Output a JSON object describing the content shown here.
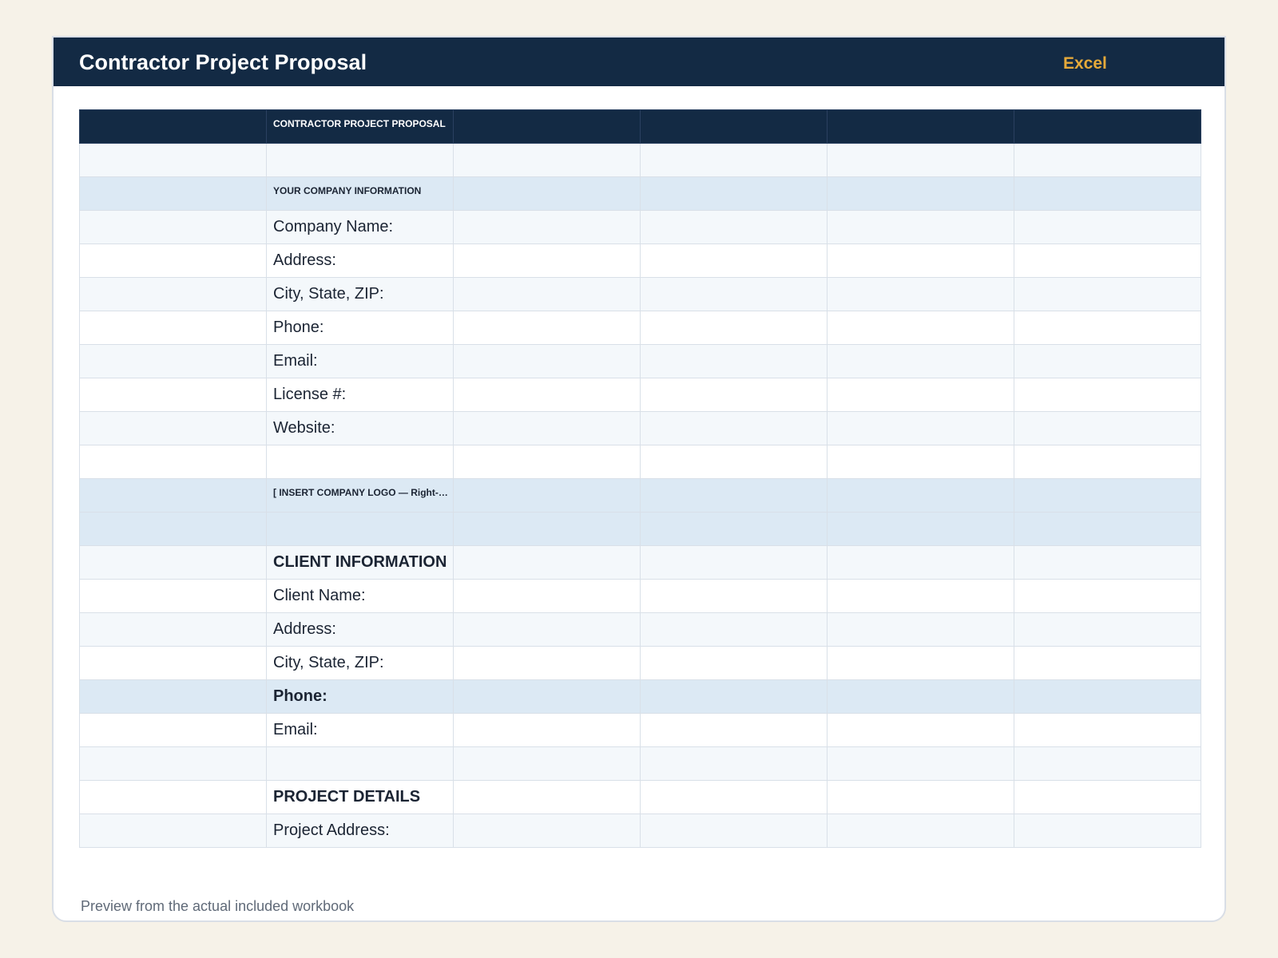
{
  "header": {
    "title": "Contractor Project Proposal",
    "badge": "Excel"
  },
  "sheet": {
    "title": "CONTRACTOR PROJECT PROPOSAL",
    "company_section": "YOUR COMPANY INFORMATION",
    "company_fields": [
      "Company Name:",
      "Address:",
      "City, State, ZIP:",
      "Phone:",
      "Email:",
      "License #:",
      "Website:"
    ],
    "logo_placeholder": "[ INSERT COMPANY LOGO — Right-cl...",
    "client_section": "CLIENT INFORMATION",
    "client_fields": [
      "Client Name:",
      "Address:",
      "City, State, ZIP:",
      "Phone:",
      "Email:"
    ],
    "project_section": "PROJECT DETAILS",
    "project_fields": [
      "Project Address:"
    ]
  },
  "footer": {
    "note": "Preview from the actual included workbook"
  },
  "colors": {
    "background": "#f6f2e8",
    "header": "#132a44",
    "badge": "#e5a93a",
    "section_fill": "#dce9f4",
    "alt_row_fill": "#f4f8fb"
  }
}
